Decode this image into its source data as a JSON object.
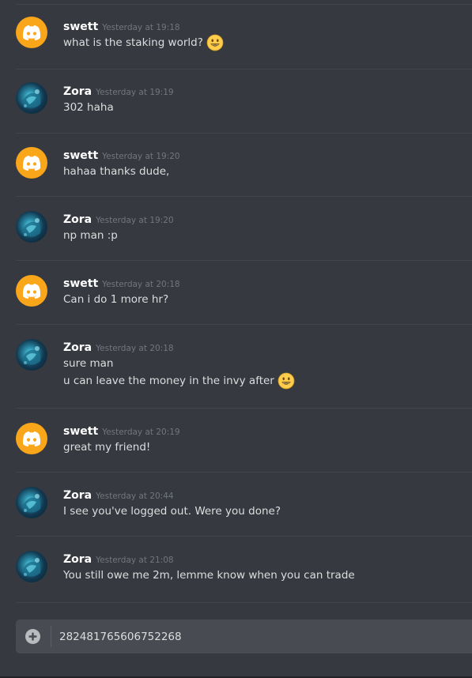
{
  "colors": {
    "background": "#36393f",
    "discord_avatar": "#faa61a",
    "username": "#ffffff",
    "timestamp": "#72767d",
    "text": "#dcddde",
    "input_background": "#484c52"
  },
  "messages": [
    {
      "author": "swett",
      "avatar": "discord-logo-icon",
      "timestamp": "Yesterday at 19:18",
      "lines": [
        {
          "text": "what is the staking world?",
          "emoji": "smiley-emoji-icon"
        }
      ]
    },
    {
      "author": "Zora",
      "avatar": "zora-avatar",
      "timestamp": "Yesterday at 19:19",
      "lines": [
        {
          "text": "302 haha"
        }
      ]
    },
    {
      "author": "swett",
      "avatar": "discord-logo-icon",
      "timestamp": "Yesterday at 19:20",
      "lines": [
        {
          "text": "hahaa thanks dude,"
        }
      ]
    },
    {
      "author": "Zora",
      "avatar": "zora-avatar",
      "timestamp": "Yesterday at 19:20",
      "lines": [
        {
          "text": "np man :p"
        }
      ]
    },
    {
      "author": "swett",
      "avatar": "discord-logo-icon",
      "timestamp": "Yesterday at 20:18",
      "lines": [
        {
          "text": "Can i do 1 more hr?"
        }
      ]
    },
    {
      "author": "Zora",
      "avatar": "zora-avatar",
      "timestamp": "Yesterday at 20:18",
      "lines": [
        {
          "text": "sure man"
        },
        {
          "text": "u can leave the money in the invy after",
          "emoji": "smiley-emoji-icon"
        }
      ]
    },
    {
      "author": "swett",
      "avatar": "discord-logo-icon",
      "timestamp": "Yesterday at 20:19",
      "lines": [
        {
          "text": "great my friend!"
        }
      ]
    },
    {
      "author": "Zora",
      "avatar": "zora-avatar",
      "timestamp": "Yesterday at 20:44",
      "lines": [
        {
          "text": "I see you've logged out. Were you done?"
        }
      ]
    },
    {
      "author": "Zora",
      "avatar": "zora-avatar",
      "timestamp": "Yesterday at 21:08",
      "lines": [
        {
          "text": "You still owe me 2m, lemme know when you can trade"
        }
      ]
    }
  ],
  "input": {
    "value": "282481765606752268",
    "attach_icon": "plus-circle-icon"
  }
}
